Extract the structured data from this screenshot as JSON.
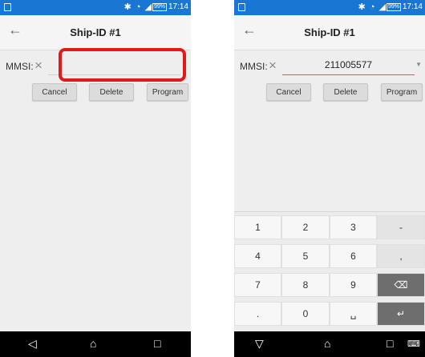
{
  "left": {
    "status": {
      "time": "17:14",
      "battery": "99%"
    },
    "title": "Ship-ID #1",
    "mmsi_label": "MMSI:",
    "mmsi_value": "",
    "buttons": {
      "cancel": "Cancel",
      "delete": "Delete",
      "program": "Program"
    },
    "highlight_color": "#e31919"
  },
  "right": {
    "status": {
      "time": "17:14",
      "battery": "99%"
    },
    "title": "Ship-ID #1",
    "mmsi_label": "MMSI:",
    "mmsi_value": "211005577",
    "buttons": {
      "cancel": "Cancel",
      "delete": "Delete",
      "program": "Program"
    },
    "keypad": {
      "rows": [
        [
          "1",
          "2",
          "3",
          "-"
        ],
        [
          "4",
          "5",
          "6",
          ","
        ],
        [
          "7",
          "8",
          "9",
          "⌫"
        ],
        [
          ".",
          "0",
          "␣",
          "↵"
        ]
      ]
    }
  },
  "icons": {
    "back": "arrow-back-icon",
    "clear": "clear-icon",
    "dropdown": "dropdown-caret-icon",
    "nav_back": "nav-back-icon",
    "nav_home": "nav-home-icon",
    "nav_recent": "nav-recent-icon",
    "keyboard": "keyboard-icon"
  },
  "colors": {
    "statusbar": "#1976d2",
    "accent": "#27a3a3"
  }
}
